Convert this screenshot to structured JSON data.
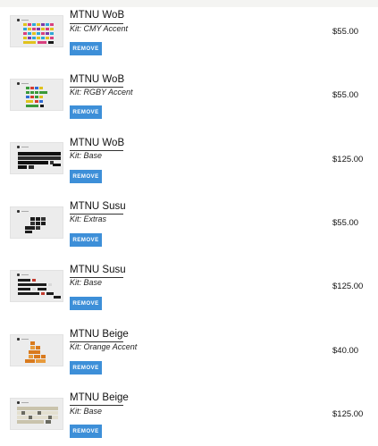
{
  "cart": {
    "items": [
      {
        "name": "MTNU WoB",
        "kit": "Kit: CMY Accent",
        "remove_label": "REMOVE",
        "price": "$55.00",
        "thumb_icon": "keycap-set-cmy-accent-image",
        "thumb_colors": [
          "#e0c21d",
          "#d9407f",
          "#2ea7d6",
          "#7c3aa8",
          "#1a1a1a"
        ]
      },
      {
        "name": "MTNU WoB",
        "kit": "Kit: RGBY Accent",
        "remove_label": "REMOVE",
        "price": "$55.00",
        "thumb_icon": "keycap-set-rgby-accent-image",
        "thumb_colors": [
          "#3a9a3a",
          "#d43d2f",
          "#2f6cd4",
          "#e0c21d",
          "#1a1a1a"
        ]
      },
      {
        "name": "MTNU WoB",
        "kit": "Kit: Base",
        "remove_label": "REMOVE",
        "price": "$125.00",
        "thumb_icon": "keycap-set-wob-base-image",
        "thumb_colors": [
          "#111111",
          "#2b2b2b"
        ]
      },
      {
        "name": "MTNU Susu",
        "kit": "Kit: Extras",
        "remove_label": "REMOVE",
        "price": "$55.00",
        "thumb_icon": "keycap-set-susu-extras-image",
        "thumb_colors": [
          "#1c1c1c",
          "#333333"
        ]
      },
      {
        "name": "MTNU Susu",
        "kit": "Kit: Base",
        "remove_label": "REMOVE",
        "price": "$125.00",
        "thumb_icon": "keycap-set-susu-base-image",
        "thumb_colors": [
          "#1c1c1c",
          "#c23b2f",
          "#d9d9d9"
        ]
      },
      {
        "name": "MTNU Beige",
        "kit": "Kit: Orange Accent",
        "remove_label": "REMOVE",
        "price": "$40.00",
        "thumb_icon": "keycap-set-beige-orange-accent-image",
        "thumb_colors": [
          "#d97a1d",
          "#e89b3c"
        ]
      },
      {
        "name": "MTNU Beige",
        "kit": "Kit: Base",
        "remove_label": "REMOVE",
        "price": "$125.00",
        "thumb_icon": "keycap-set-beige-base-image",
        "thumb_colors": [
          "#e3dfcf",
          "#6a6a60",
          "#c9c3ac"
        ]
      }
    ]
  },
  "colors": {
    "button": "#3d8fd8",
    "button_text": "#ffffff"
  }
}
